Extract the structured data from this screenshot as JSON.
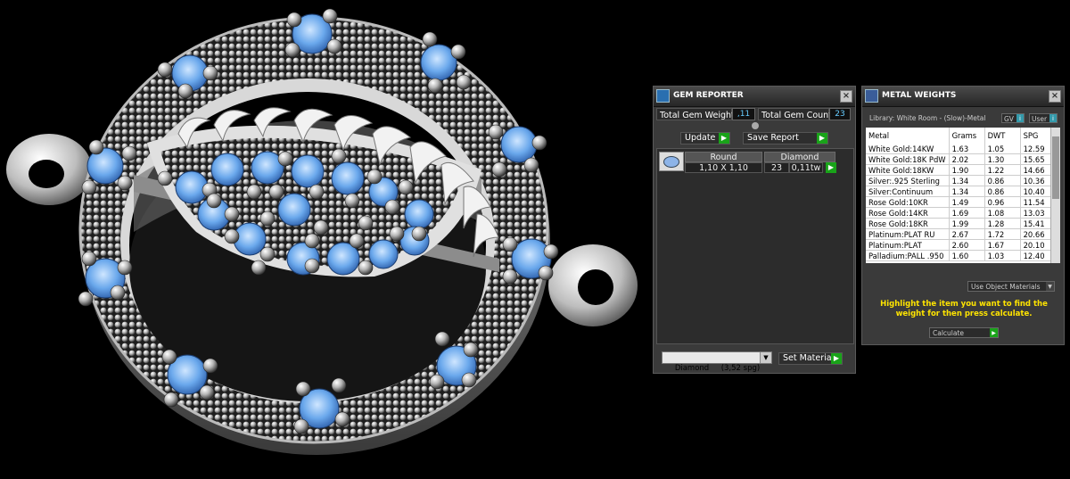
{
  "gem_reporter": {
    "title": "GEM REPORTER",
    "total_weight_label": "Total Gem Weight",
    "total_weight_value": ",11",
    "total_count_label": "Total Gem Count",
    "total_count_value": "23",
    "update_label": "Update",
    "save_report_label": "Save Report",
    "table": {
      "cut": "Round",
      "material": "Diamond",
      "size": "1,10 X 1,10",
      "count": "23",
      "weight": "0,11tw"
    },
    "material_select": "Diamond     (3,52 spg)",
    "set_material_label": "Set Material"
  },
  "metal_weights": {
    "title": "METAL WEIGHTS",
    "library": "Library: White Room - (Slow)-Metal",
    "gv_label": "GV",
    "user_label": "User",
    "columns": [
      "Metal",
      "Grams",
      "DWT",
      "SPG"
    ],
    "rows": [
      [
        "White Gold:14KW",
        "1.63",
        "1.05",
        "12.59"
      ],
      [
        "White Gold:18K PdW",
        "2.02",
        "1.30",
        "15.65"
      ],
      [
        "White Gold:18KW",
        "1.90",
        "1.22",
        "14.66"
      ],
      [
        "Silver:.925 Sterling",
        "1.34",
        "0.86",
        "10.36"
      ],
      [
        "Silver:Continuum",
        "1.34",
        "0.86",
        "10.40"
      ],
      [
        "Rose Gold:10KR",
        "1.49",
        "0.96",
        "11.54"
      ],
      [
        "Rose Gold:14KR",
        "1.69",
        "1.08",
        "13.03"
      ],
      [
        "Rose Gold:18KR",
        "1.99",
        "1.28",
        "15.41"
      ],
      [
        "Platinum:PLAT RU",
        "2.67",
        "1.72",
        "20.66"
      ],
      [
        "Platinum:PLAT",
        "2.60",
        "1.67",
        "20.10"
      ],
      [
        "Palladium:PALL .950",
        "1.60",
        "1.03",
        "12.40"
      ]
    ],
    "use_object_materials": "Use Object Materials",
    "instruction": "Highlight the item you want to find the weight for then press calculate.",
    "calculate_label": "Calculate"
  },
  "colors": {
    "gem": "#6aa8ec",
    "metal": "#cfcfcf",
    "accent": "#19a319",
    "highlight_text": "#ffe400"
  }
}
